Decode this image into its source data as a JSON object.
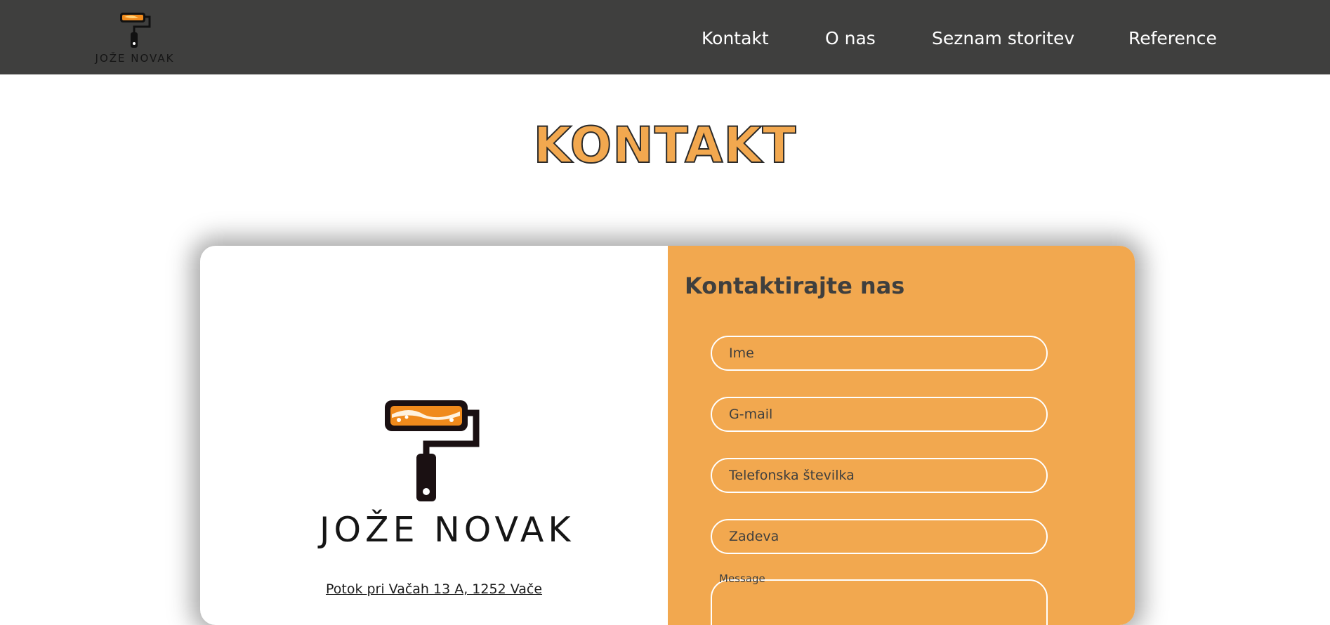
{
  "colors": {
    "header_bg": "#3f3f3e",
    "accent": "#f2a84f",
    "text_dark": "#3f3f3e",
    "white": "#ffffff"
  },
  "header": {
    "logo_text": "JOŽE NOVAK",
    "logo_icon": "paint-roller-icon",
    "nav": [
      "Kontakt",
      "O nas",
      "Seznam storitev",
      "Reference"
    ]
  },
  "page_title": "KONTAKT",
  "contact_card": {
    "logo_text": "JOŽE NOVAK",
    "logo_icon": "paint-roller-icon",
    "address": "Potok pri Vačah 13 A, 1252 Vače",
    "form": {
      "title": "Kontaktirajte nas",
      "name_placeholder": "Ime",
      "email_placeholder": "G-mail",
      "phone_placeholder": "Telefonska številka",
      "subject_placeholder": "Zadeva",
      "message_label": "Message"
    }
  }
}
